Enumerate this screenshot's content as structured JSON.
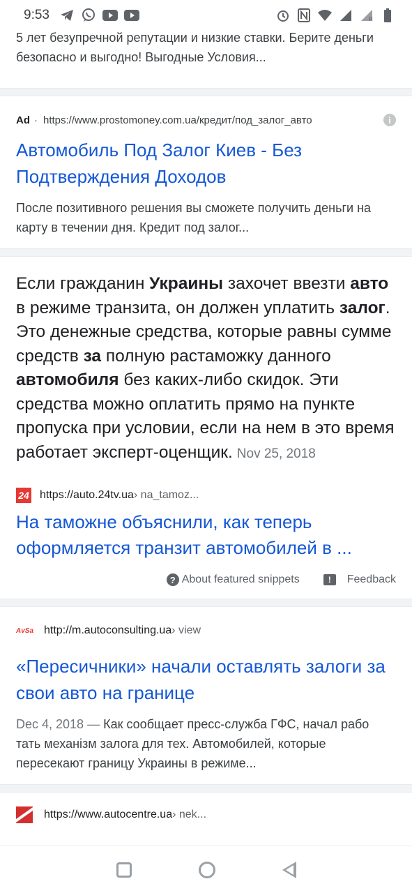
{
  "status_bar": {
    "time": "9:53",
    "left_icons": [
      "telegram-icon",
      "viber-icon",
      "youtube-icon",
      "youtube-icon"
    ],
    "right_icons": [
      "alarm-icon",
      "nfc-icon",
      "wifi-icon",
      "signal-icon",
      "signal-roaming-icon",
      "battery-icon"
    ]
  },
  "top_snippet": {
    "text": "5 лет безупречной репутации и низкие ставки. Берите деньги безопасно и выгодно! Выгодные Условия..."
  },
  "ad": {
    "label": "Ad",
    "separator": "·",
    "url": "https://www.prostomoney.com.ua/кредит/под_залог_авто",
    "title": "Автомобиль Под Залог Киев - Без Подтверждения Доходов",
    "description": "После позитивного решения вы сможете получить деньги на карту в течении дня. Кредит под залог..."
  },
  "featured_snippet": {
    "parts": [
      {
        "t": "Если гражданин ",
        "b": false
      },
      {
        "t": "Украины",
        "b": true
      },
      {
        "t": " захочет ввезти ",
        "b": false
      },
      {
        "t": "авто",
        "b": true
      },
      {
        "t": " в режиме транзита, он должен уплатить ",
        "b": false
      },
      {
        "t": "залог",
        "b": true
      },
      {
        "t": ". Это денежные средства, которые равны сумме средств ",
        "b": false
      },
      {
        "t": "за",
        "b": true
      },
      {
        "t": " полную растаможку данного ",
        "b": false
      },
      {
        "t": "автомобиля",
        "b": true
      },
      {
        "t": " без каких-либо скидок. Эти средства можно оплатить прямо на пункте пропуска при условии, если на нем в это время работает эксперт-оценщик.",
        "b": false
      }
    ],
    "date": "Nov 25, 2018",
    "favicon_text": "24",
    "site_url": "https://auto.24tv.ua",
    "site_crumb": " › na_tamoz...",
    "title": "На таможне объяснили, как теперь оформляется транзит автомобилей в ...",
    "about_label": "About featured snippets",
    "feedback_label": "Feedback"
  },
  "result1": {
    "favicon_text": "AvSa",
    "site_url": "http://m.autoconsulting.ua",
    "site_crumb": " › view",
    "title": "«Пересичники» начали оставлять залоги за свои авто на границе",
    "date": "Dec 4, 2018",
    "dash": " — ",
    "description": "Как сообщает пресс-служба ГФС, начал рабо тать механізм залога для тех. Автомобилей, которые пересекают границу Украины в режиме..."
  },
  "result2": {
    "site_url": "https://www.autocentre.ua",
    "site_crumb": " › nek..."
  },
  "nav_bar": {
    "icons": [
      "recents-icon",
      "home-icon",
      "back-icon"
    ]
  }
}
